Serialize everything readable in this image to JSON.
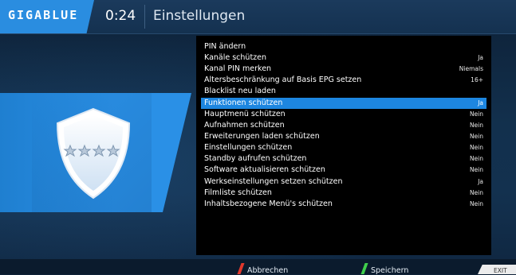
{
  "header": {
    "logo": "GIGABLUE",
    "clock": "0:24",
    "title": "Einstellungen"
  },
  "menu": {
    "items": [
      {
        "label": "PIN ändern",
        "value": ""
      },
      {
        "label": "Kanäle schützen",
        "value": "Ja"
      },
      {
        "label": "Kanal PIN merken",
        "value": "Niemals"
      },
      {
        "label": "Altersbeschränkung auf Basis EPG setzen",
        "value": "16+"
      },
      {
        "label": "Blacklist neu laden",
        "value": ""
      },
      {
        "label": "Funktionen schützen",
        "value": "Ja",
        "selected": true
      },
      {
        "label": "Hauptmenü schützen",
        "value": "Nein"
      },
      {
        "label": "Aufnahmen schützen",
        "value": "Nein"
      },
      {
        "label": "Erweiterungen laden schützen",
        "value": "Nein"
      },
      {
        "label": "Einstellungen schützen",
        "value": "Nein"
      },
      {
        "label": "Standby aufrufen schützen",
        "value": "Nein"
      },
      {
        "label": "Software aktualisieren schützen",
        "value": "Nein"
      },
      {
        "label": "Werkseinstellungen setzen schützen",
        "value": "Ja"
      },
      {
        "label": "Filmliste schützen",
        "value": "Nein"
      },
      {
        "label": "Inhaltsbezogene Menü's schützen",
        "value": "Nein"
      }
    ]
  },
  "footer": {
    "cancel_label": "Abbrechen",
    "save_label": "Speichern",
    "exit_label": "EXIT"
  },
  "colors": {
    "accent": "#1d86e0",
    "red_key": "#e2382c",
    "green_key": "#3fcf4c"
  },
  "icons": {
    "shield": "shield-stars-icon"
  }
}
